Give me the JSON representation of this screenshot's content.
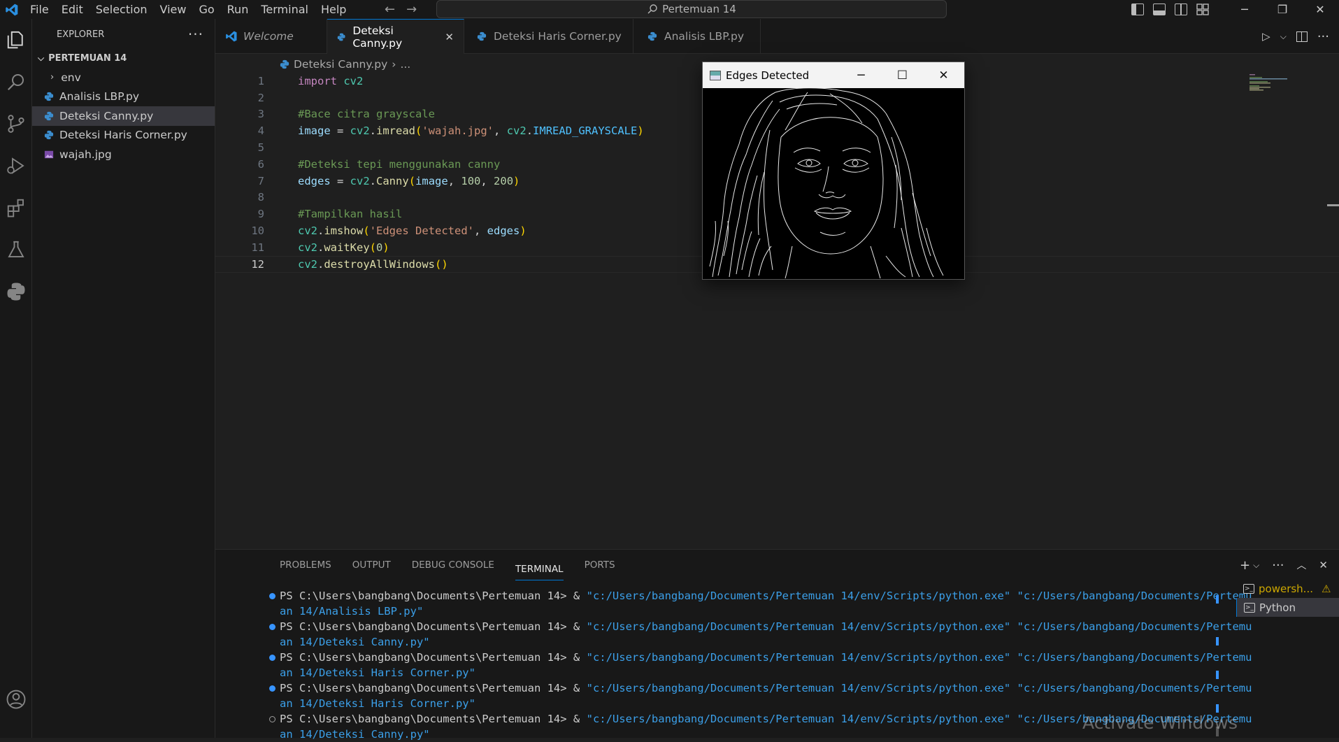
{
  "menu": [
    "File",
    "Edit",
    "Selection",
    "View",
    "Go",
    "Run",
    "Terminal",
    "Help"
  ],
  "search": {
    "label": "Pertemuan 14"
  },
  "sidebar": {
    "title": "EXPLORER",
    "folder": "PERTEMUAN 14",
    "items": [
      {
        "label": "env",
        "type": "folder"
      },
      {
        "label": "Analisis LBP.py",
        "type": "py"
      },
      {
        "label": "Deteksi Canny.py",
        "type": "py",
        "active": true
      },
      {
        "label": "Deteksi Haris Corner.py",
        "type": "py"
      },
      {
        "label": "wajah.jpg",
        "type": "image"
      }
    ]
  },
  "tabs": [
    {
      "label": "Welcome"
    },
    {
      "label": "Deteksi Canny.py",
      "active": true
    },
    {
      "label": "Deteksi Haris Corner.py"
    },
    {
      "label": "Analisis LBP.py"
    }
  ],
  "breadcrumb": {
    "file": "Deteksi Canny.py",
    "more": "..."
  },
  "code": {
    "line_numbers": [
      "1",
      "2",
      "3",
      "4",
      "5",
      "6",
      "7",
      "8",
      "9",
      "10",
      "11",
      "12"
    ],
    "l1_import": "import",
    "l1_mod": "cv2",
    "l3_comment": "#Bace citra grayscale",
    "l4_image": "image",
    "l4_eq": " = ",
    "l4_cv2": "cv2",
    "l4_fn": "imread",
    "l4_str": "'wajah.jpg'",
    "l4_const": "IMREAD_GRAYSCALE",
    "l6_comment": "#Deteksi tepi menggunakan canny",
    "l7_edges": "edges",
    "l7_fn": "Canny",
    "l7_arg": "image",
    "l7_n1": "100",
    "l7_n2": "200",
    "l9_comment": "#Tampilkan hasil",
    "l10_fn": "imshow",
    "l10_str": "'Edges Detected'",
    "l10_arg": "edges",
    "l11_fn": "waitKey",
    "l11_n": "0",
    "l12_fn": "destroyAllWindows"
  },
  "cv_window": {
    "title": "Edges Detected"
  },
  "panel": {
    "tabs": [
      "PROBLEMS",
      "OUTPUT",
      "DEBUG CONSOLE",
      "TERMINAL",
      "PORTS"
    ],
    "active_tab": "TERMINAL",
    "prompt": "PS C:\\Users\\bangbang\\Documents\\Pertemuan 14> & ",
    "exe": "\"c:/Users/bangbang/Documents/Pertemuan 14/env/Scripts/python.exe\" \"c:/Users/bangbang/Documents/Pertemu",
    "runs": [
      "an 14/Analisis LBP.py\"",
      "an 14/Deteksi Canny.py\"",
      "an 14/Deteksi Haris Corner.py\"",
      "an 14/Deteksi Haris Corner.py\"",
      "an 14/Deteksi Canny.py\""
    ],
    "terminals": [
      {
        "label": "powersh..."
      },
      {
        "label": "Python"
      }
    ]
  },
  "watermark": "Activate Windows",
  "colors": {
    "accent": "#0078d4",
    "python_icon": "#3b8ed0"
  }
}
